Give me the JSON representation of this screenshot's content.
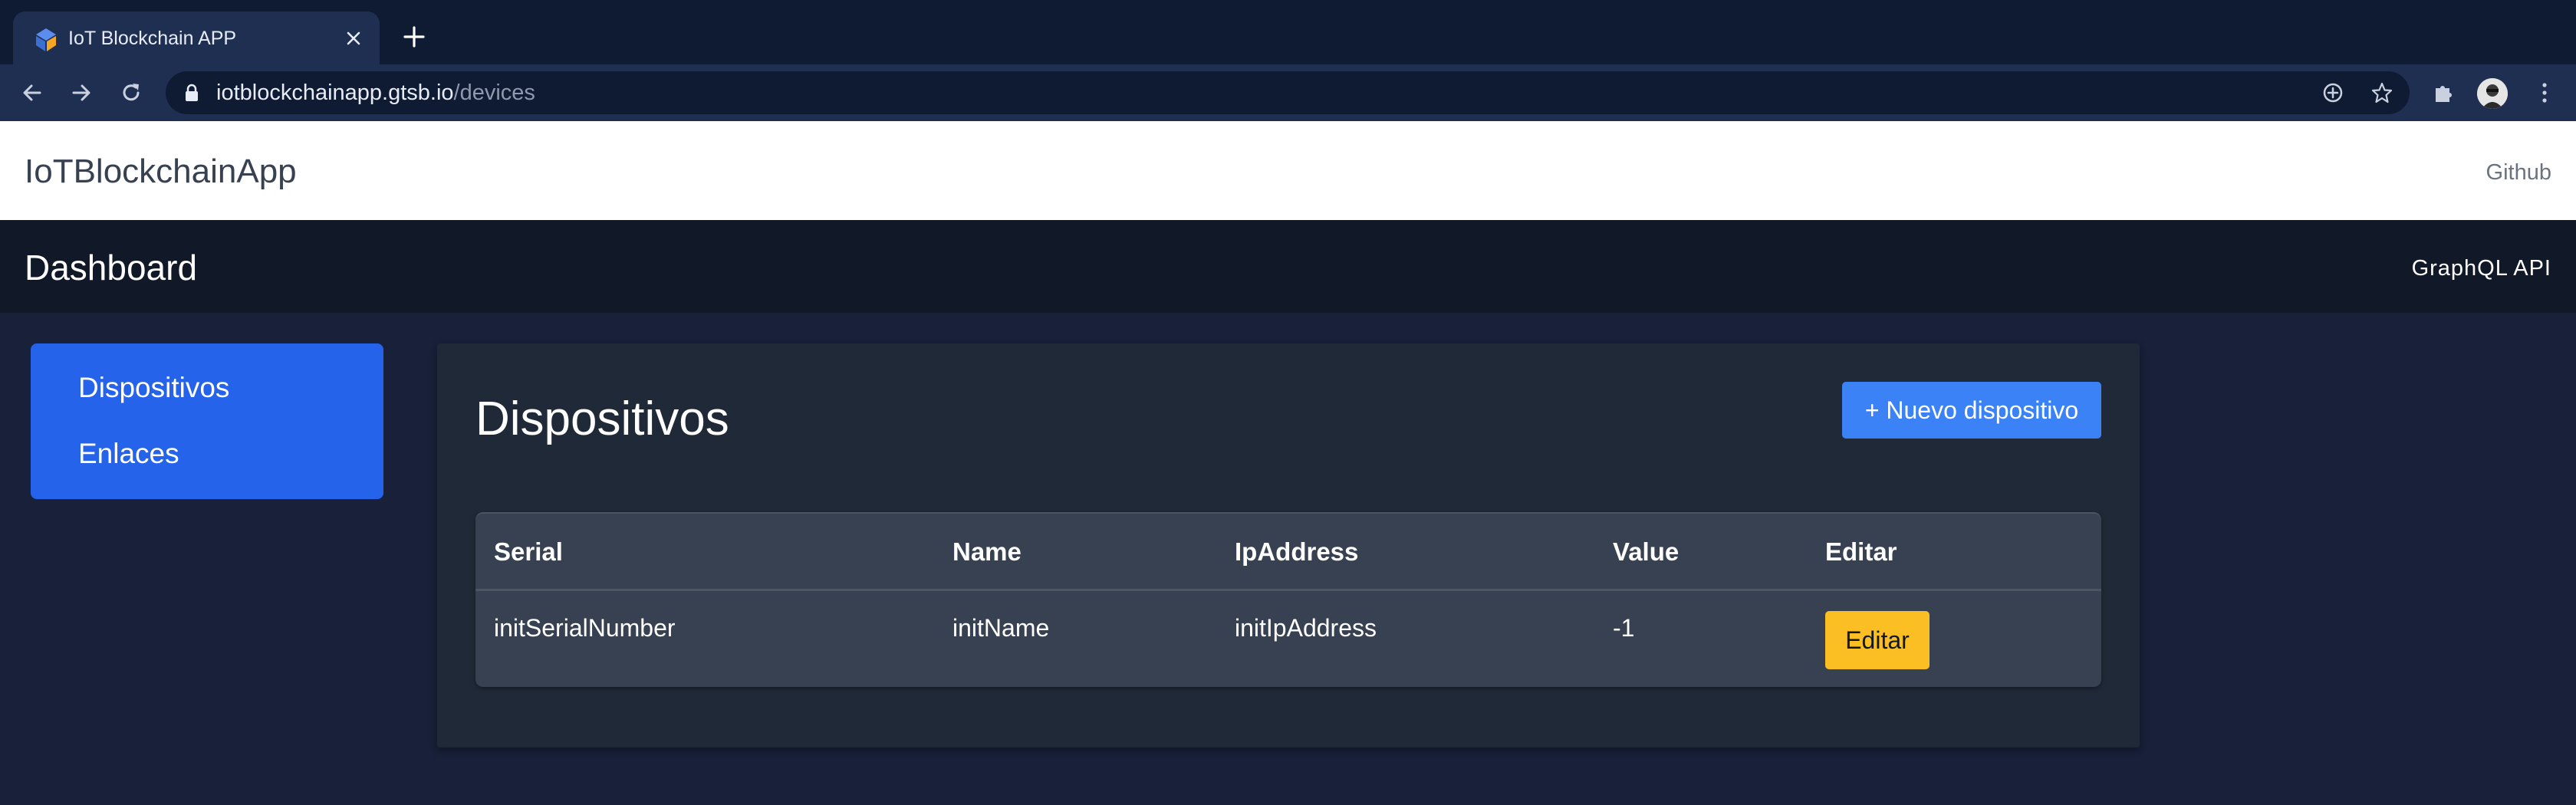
{
  "browser": {
    "tab_title": "IoT Blockchain APP",
    "url_domain": "iotblockchainapp.gtsb.io",
    "url_path": "/devices"
  },
  "app": {
    "brand": "IoTBlockchainApp",
    "github_link": "Github",
    "dashboard_title": "Dashboard",
    "graphql_link": "GraphQL API"
  },
  "sidebar": {
    "items": [
      {
        "label": "Dispositivos"
      },
      {
        "label": "Enlaces"
      }
    ]
  },
  "main": {
    "title": "Dispositivos",
    "new_button": "+ Nuevo dispositivo",
    "table": {
      "headers": [
        "Serial",
        "Name",
        "IpAddress",
        "Value",
        "Editar"
      ],
      "rows": [
        {
          "serial": "initSerialNumber",
          "name": "initName",
          "ip": "initIpAddress",
          "value": "-1",
          "edit": "Editar"
        }
      ]
    }
  },
  "colors": {
    "page_bg": "#18203a",
    "sidebar": "#2563eb",
    "primary_button": "#3b82f6",
    "edit_button": "#fbbf24"
  }
}
